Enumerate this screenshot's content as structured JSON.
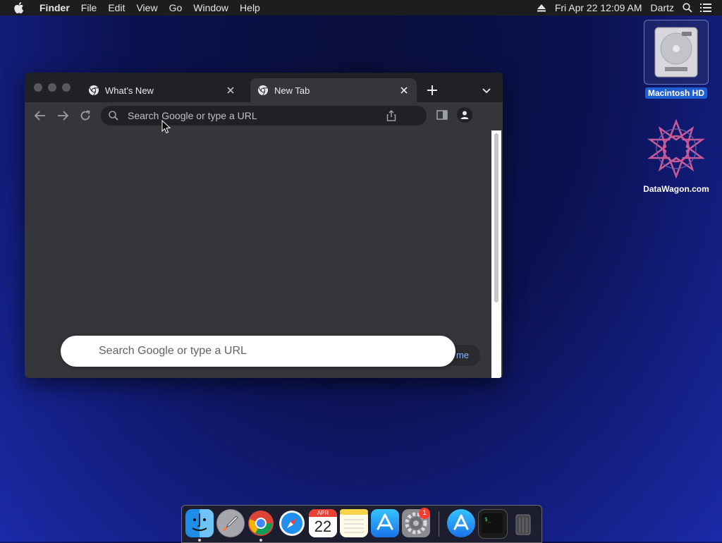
{
  "menubar": {
    "app_name": "Finder",
    "menus": [
      "File",
      "Edit",
      "View",
      "Go",
      "Window"
    ],
    "help": "Help",
    "clock": "Fri Apr 22  12:09 AM",
    "user": "Dartz"
  },
  "desktop": {
    "icons": [
      {
        "label": "Macintosh HD",
        "icon": "hard-drive-icon",
        "selected": true
      },
      {
        "label": "DataWagon.com",
        "icon": "datawagon-logo-icon",
        "selected": false
      }
    ]
  },
  "browser": {
    "tabs": [
      {
        "title": "What's New",
        "active": false
      },
      {
        "title": "New Tab",
        "active": true
      }
    ],
    "omnibox_placeholder": "Search Google or type a URL",
    "customize_label": "me",
    "search_placeholder": "Search Google or type a URL"
  },
  "dock": {
    "apps": [
      "Finder",
      "Launchpad",
      "Google Chrome",
      "Safari",
      "Calendar",
      "Notes",
      "App Store",
      "System Preferences",
      "App Store",
      "Terminal",
      "Trash"
    ],
    "calendar_month": "APR",
    "calendar_day": "22",
    "system_prefs_badge": "1"
  },
  "colors": {
    "accent": "#1f5fd0",
    "browser_bg": "#35363a",
    "tabstrip_bg": "#202124"
  }
}
